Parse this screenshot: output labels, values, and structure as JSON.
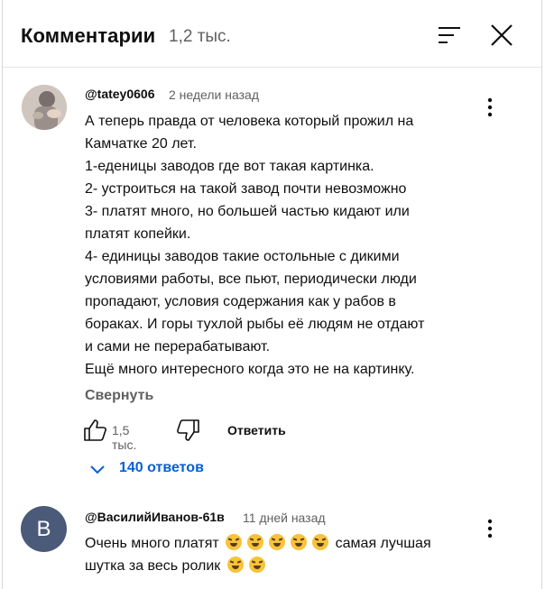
{
  "header": {
    "title": "Комментарии",
    "count": "1,2 тыс."
  },
  "comments": [
    {
      "author": "@tatey0606",
      "time": "2 недели назад",
      "lines": [
        "А теперь правда от человека который прожил на",
        "Камчатке 20 лет.",
        "1-еденицы заводов где вот такая картинка.",
        "2- устроиться на такой завод почти невозможно",
        "3- платят много, но большей частью кидают или",
        "платят копейки.",
        "4- единицы заводов такие остольные с дикими",
        "условиями работы, все пьют, периодически люди",
        "пропадают, условия содержания как у рабов в",
        "бораках. И горы тухлой рыбы её людям не отдают",
        "и сами не перерабатывают.",
        "Ещё много интересного когда это не на картинку."
      ],
      "collapse_label": "Свернуть",
      "likes": "1,5 тыс.",
      "reply_label": "Ответить",
      "replies_label": "140 ответов"
    },
    {
      "author": "@ВасилийИванов-61в",
      "avatar_letter": "B",
      "time": "11 дней назад",
      "line1_text": "Очень много платят",
      "line1_after": "самая лучшая",
      "line2_text": "шутка за весь ролик"
    }
  ],
  "icons": {
    "sort": "sort-icon",
    "close": "close-icon",
    "more": "more-vert-icon",
    "like": "thumb-up-icon",
    "dislike": "thumb-down-icon",
    "chevron": "chevron-down-icon",
    "emoji": "rofl-emoji"
  },
  "colors": {
    "link": "#065fd4",
    "secondary": "#606060",
    "text": "#0f0f0f"
  }
}
